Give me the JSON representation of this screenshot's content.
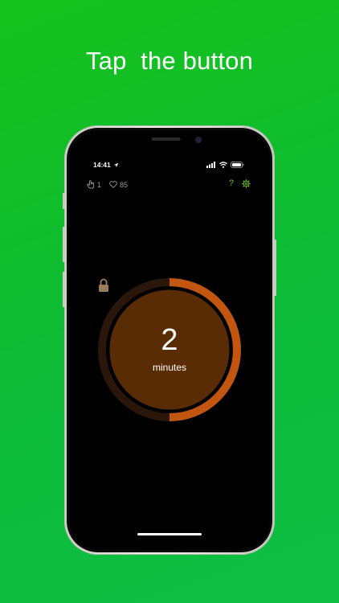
{
  "headline": "Tap  the button",
  "status_bar": {
    "time": "14:41",
    "icons": [
      "location-arrow-icon",
      "signal-icon",
      "wifi-icon",
      "battery-icon"
    ]
  },
  "top_bar": {
    "taps_count": "1",
    "likes_count": "85",
    "help_label": "?",
    "icons": [
      "tap-icon",
      "heart-icon",
      "settings-icon"
    ]
  },
  "timer": {
    "value": "2",
    "unit": "minutes",
    "progress_fraction": 0.5,
    "locked": true
  },
  "colors": {
    "background_green": "#16c21b",
    "ring_orange": "#c2550f",
    "ring_track": "#2a160a",
    "button_fill": "#5a2c06",
    "accent_green": "#6abf1f"
  }
}
